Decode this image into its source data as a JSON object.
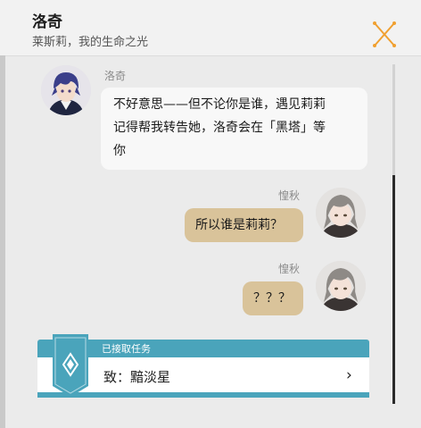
{
  "header": {
    "title": "洛奇",
    "subtitle": "莱斯莉，我的生命之光"
  },
  "messages": [
    {
      "sender": "洛奇",
      "side": "left",
      "text_lines": [
        "不好意思——但不论你是谁，遇见莉莉",
        "记得帮我转告她，洛奇会在「黑塔」等",
        "你"
      ]
    },
    {
      "sender": "惶秋",
      "side": "right",
      "text_lines": [
        "所以谁是莉莉？"
      ]
    },
    {
      "sender": "惶秋",
      "side": "right",
      "text_lines": [
        "？？？"
      ]
    }
  ],
  "quest": {
    "status": "已接取任务",
    "name": "致：黯淡星",
    "chevron": "›"
  },
  "colors": {
    "accent_orange": "#f0a030",
    "quest_teal": "#4aa4bb",
    "reply_bubble": "#d9c39a"
  },
  "icons": [
    "close-icon",
    "quest-emblem-icon",
    "chevron-right-icon"
  ]
}
